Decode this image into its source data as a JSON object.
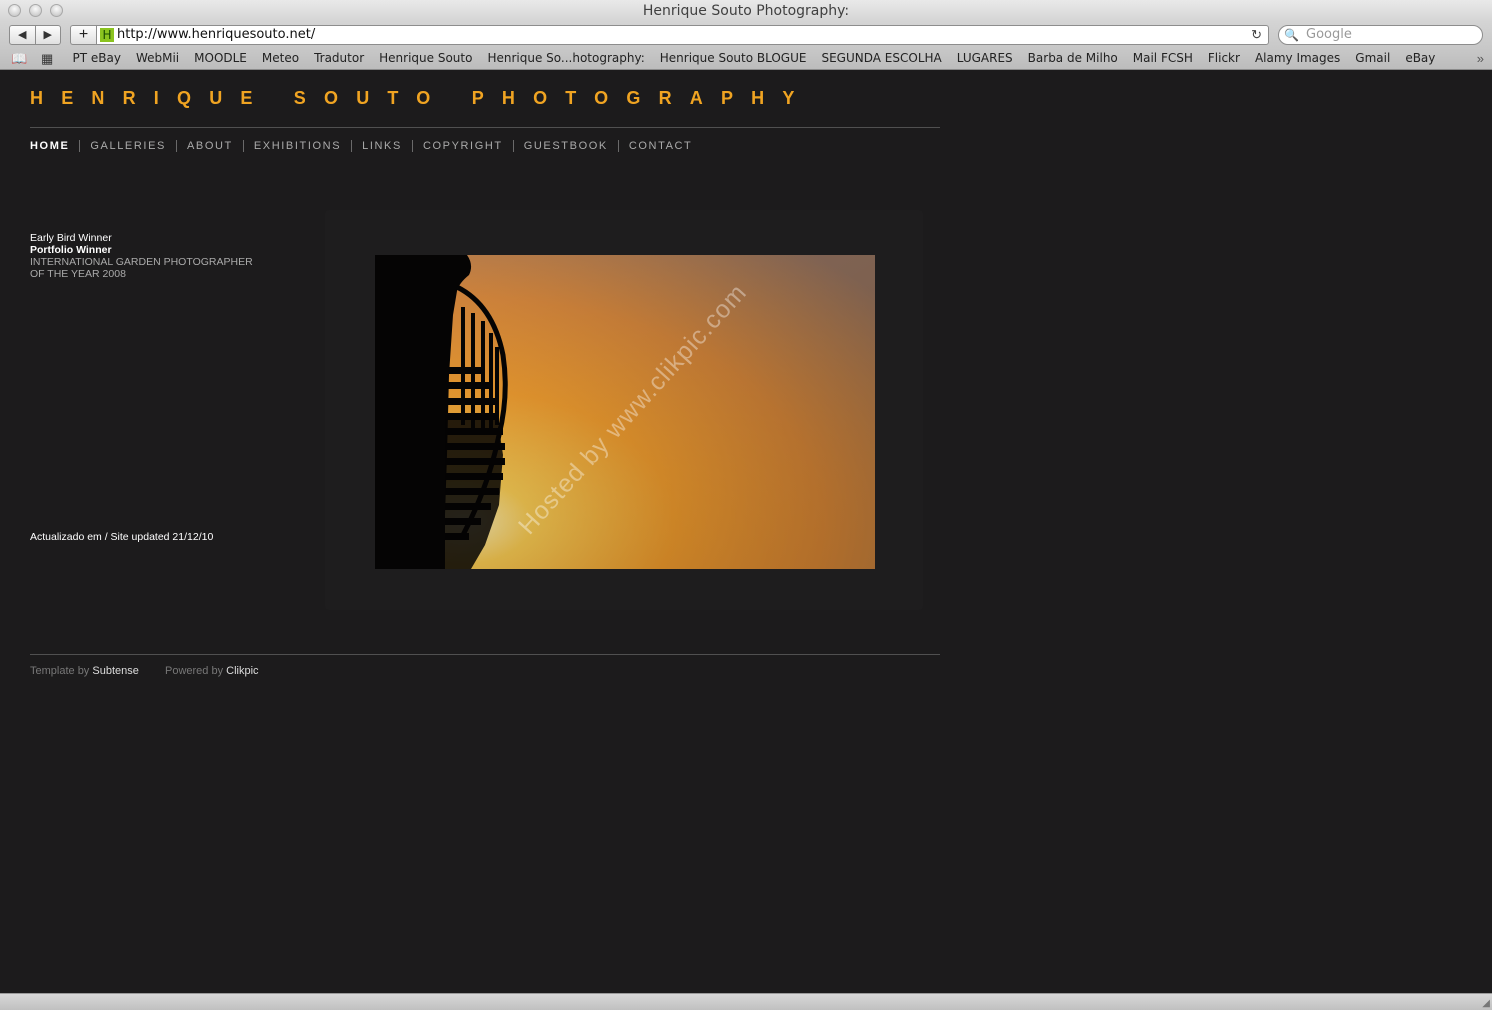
{
  "window": {
    "title": "Henrique Souto Photography:"
  },
  "toolbar": {
    "back_icon": "◀",
    "forward_icon": "▶",
    "add_icon": "+",
    "favicon_letter": "H",
    "url": "http://www.henriquesouto.net/",
    "reload_icon": "↻",
    "search_icon": "🔍",
    "search_placeholder": "Google"
  },
  "bookmarks": {
    "reading_list_icon": "📖",
    "top_sites_icon": "▦",
    "more_icon": "»",
    "items": [
      "PT eBay",
      "WebMii",
      "MOODLE",
      "Meteo",
      "Tradutor",
      "Henrique Souto",
      "Henrique So...hotography:",
      "Henrique Souto BLOGUE",
      "SEGUNDA ESCOLHA",
      "LUGARES",
      "Barba de Milho",
      "Mail FCSH",
      "Flickr",
      "Alamy Images",
      "Gmail",
      "eBay"
    ]
  },
  "site": {
    "title": "HENRIQUE SOUTO PHOTOGRAPHY",
    "nav": [
      "HOME",
      "GALLERIES",
      "ABOUT",
      "EXHIBITIONS",
      "LINKS",
      "COPYRIGHT",
      "GUESTBOOK",
      "CONTACT"
    ],
    "awards": {
      "line1": "Early Bird Winner",
      "line2": "Portfolio Winner",
      "line3": "INTERNATIONAL GARDEN PHOTOGRAPHER",
      "line4": "OF THE YEAR 2008"
    },
    "updated": "Actualizado em / Site updated 21/12/10",
    "photo_watermark": "Hosted by www.clikpic.com",
    "footer": {
      "template_label": "Template by",
      "template_link": "Subtense",
      "powered_label": "Powered by",
      "powered_link": "Clikpic"
    }
  },
  "colors": {
    "page_bg": "#1c1b1c",
    "brand_orange": "#f0a422",
    "nav_text": "#aaaaaa",
    "nav_active": "#ffffff"
  }
}
